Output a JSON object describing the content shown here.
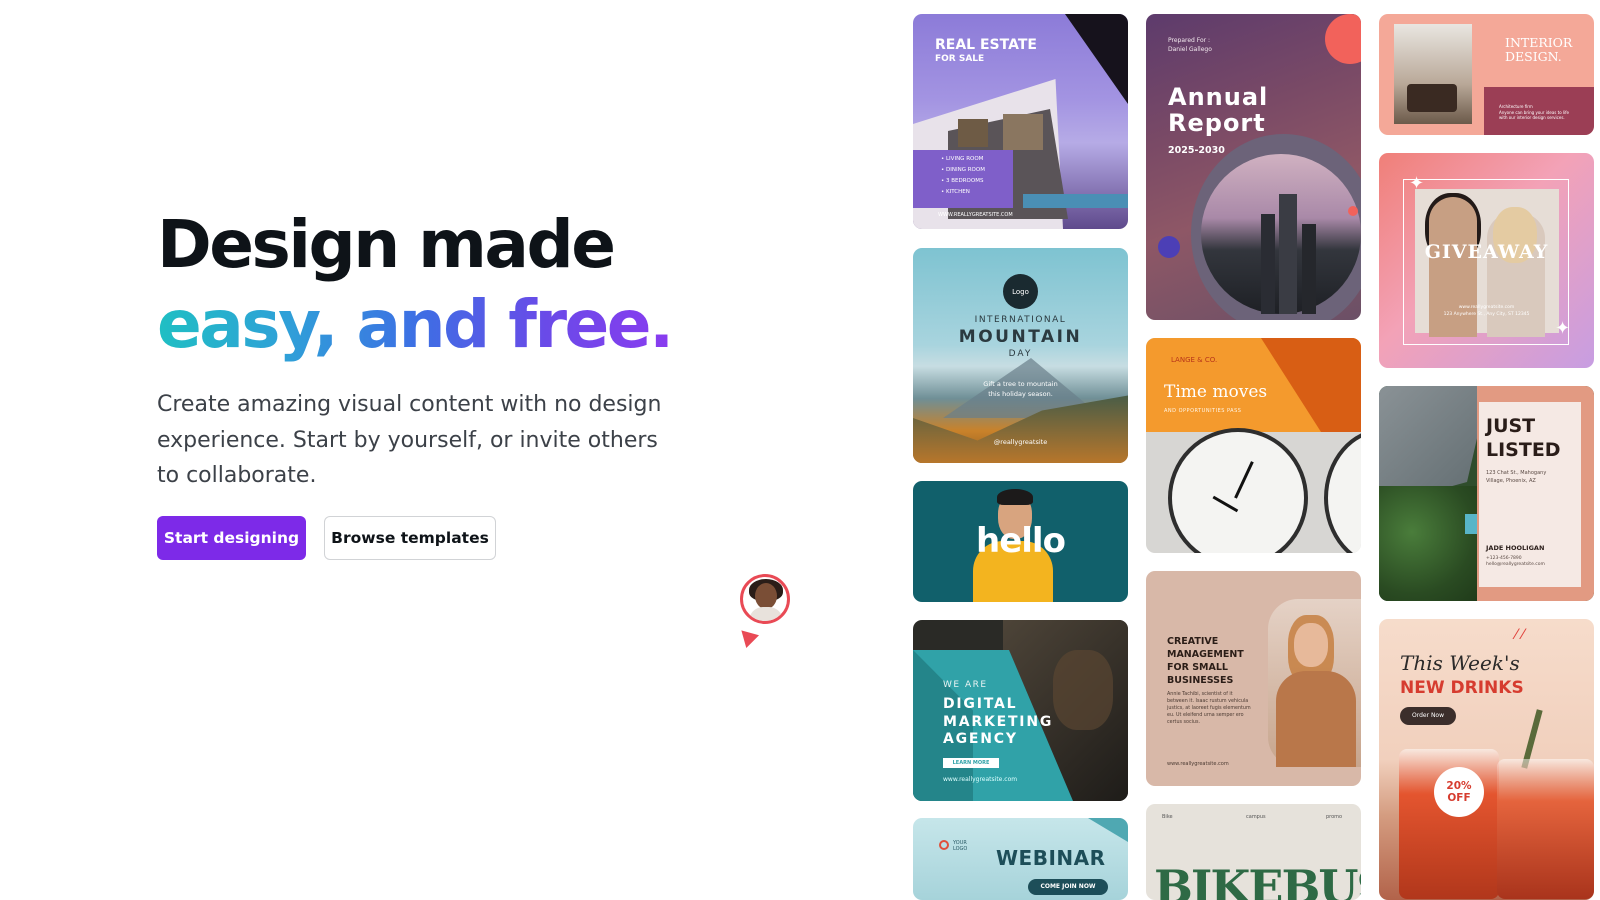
{
  "hero": {
    "headline_line1": "Design made",
    "headline_line2": "easy, and free.",
    "subtitle": "Create amazing visual content with no design experience. Start by yourself, or invite others to collaborate.",
    "primary_button": "Start designing",
    "secondary_button": "Browse templates"
  },
  "colors": {
    "brand_purple": "#7d2ae8",
    "gradient_start": "#1fbfc3",
    "gradient_end": "#8b3bf0",
    "cursor_red": "#e94a55"
  },
  "templates": {
    "real_estate": {
      "title": "REAL ESTATE",
      "subtitle": "FOR SALE",
      "features": "• LIVING ROOM\n• DINING ROOM\n• 3 BEDROOMS\n• KITCHEN",
      "url": "WWW.REALLYGREATSITE.COM"
    },
    "mountain": {
      "logo": "Logo",
      "line1": "INTERNATIONAL",
      "line2": "MOUNTAIN",
      "line3": "DAY",
      "tagline": "Gift a tree to mountain\nthis holiday season.",
      "handle": "@reallygreatsite"
    },
    "hello": {
      "word": "hello"
    },
    "digital": {
      "pre": "WE ARE",
      "title": "DIGITAL\nMARKETING\nAGENCY",
      "cta": "LEARN MORE",
      "url": "www.reallygreatsite.com"
    },
    "webinar": {
      "logo_text": "YOUR\nLOGO",
      "title": "WEBINAR",
      "cta": "COME JOIN NOW"
    },
    "annual_report": {
      "prepared": "Prepared For :\nDaniel Gallego",
      "title": "Annual\nReport",
      "years": "2025-2030"
    },
    "time_moves": {
      "brand": "LANGE & CO.",
      "title": "Time moves",
      "subtitle": "AND OPPORTUNITIES PASS"
    },
    "creative": {
      "title": "CREATIVE\nMANAGEMENT\nFOR SMALL\nBUSINESSES",
      "body": "Annie Tachibi, scientist of it\nbetween it. Isaac rustum vehicula\njustics, at laoreet fugis elementum\neu. Ut eleifend urna semper ero\ncertus socius.",
      "url": "www.reallygreatsite.com"
    },
    "bike": {
      "header_left": "Bike",
      "header_center": "campus",
      "header_right": "promo",
      "title": "BIKEBUSALE"
    },
    "interior": {
      "title": "INTERIOR\nDESIGN.",
      "body": "Architecture firm\nAnyone can bring your ideas to life\nwith our interior design services."
    },
    "giveaway": {
      "title": "GIVEAWAY",
      "details": "www.reallygreatsite.com\n123 Anywhere St., Any City, ST 12345"
    },
    "just_listed": {
      "title": "JUST\nLISTED",
      "address": "123 Chat St., Mahogany\nVillage, Phoenix, AZ",
      "agent": "JADE HOOLIGAN",
      "contact": "+123-456-7890\nhello@reallygreatsite.com"
    },
    "drinks": {
      "title1": "This Week's",
      "title2": "NEW DRINKS",
      "cta": "Order Now",
      "badge": "20%\nOFF"
    }
  }
}
